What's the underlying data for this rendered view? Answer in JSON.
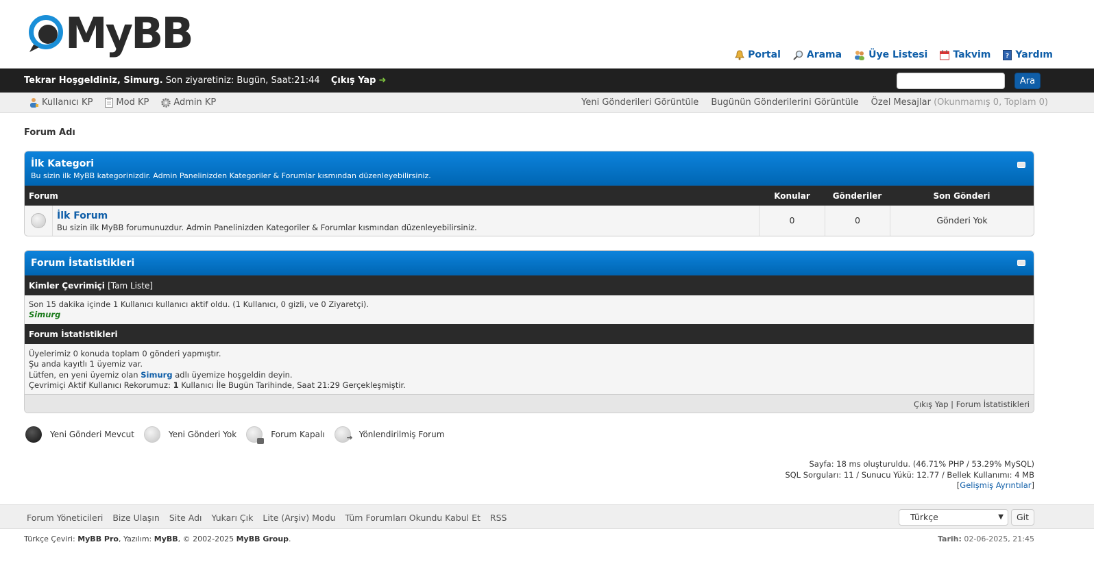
{
  "logo": {
    "text": "MyBB"
  },
  "menu": {
    "portal": "Portal",
    "search": "Arama",
    "members": "Üye Listesi",
    "calendar": "Takvim",
    "help": "Yardım"
  },
  "panel": {
    "welcome_bold": "Tekrar Hoşgeldiniz, Simurg.",
    "last_visit": "Son ziyaretiniz: Bugün, Saat:21:44",
    "logout": "Çıkış Yap",
    "logout_arrow": "➜",
    "search_value": "",
    "search_button": "Ara"
  },
  "userbar": {
    "user_cp": "Kullanıcı KP",
    "mod_cp": "Mod KP",
    "admin_cp": "Admin KP",
    "new_posts": "Yeni Gönderileri Görüntüle",
    "today_posts": "Bugünün Gönderilerini Görüntüle",
    "pm": "Özel Mesajlar",
    "pm_counts": "(Okunmamış 0, Toplam 0)"
  },
  "breadcrumb": "Forum Adı",
  "category": {
    "title": "İlk Kategori",
    "description": "Bu sizin ilk MyBB kategorinizdir. Admin Panelinizden Kategoriler & Forumlar kısmından düzenleyebilirsiniz.",
    "columns": {
      "forum": "Forum",
      "threads": "Konular",
      "posts": "Gönderiler",
      "last_post": "Son Gönderi"
    },
    "forums": [
      {
        "name": "İlk Forum",
        "description": "Bu sizin ilk MyBB forumunuzdur. Admin Panelinizden Kategoriler & Forumlar kısmından düzenleyebilirsiniz.",
        "threads": "0",
        "posts": "0",
        "last_post": "Gönderi Yok"
      }
    ]
  },
  "stats": {
    "title": "Forum İstatistikleri",
    "online_header": "Kimler Çevrimiçi",
    "online_full_list": "[Tam Liste]",
    "online_text": "Son 15 dakika içinde 1 Kullanıcı kullanıcı aktif oldu. (1 Kullanıcı, 0 gizli, ve 0 Ziyaretçi).",
    "online_user": "Simurg",
    "stats_header": "Forum İstatistikleri",
    "line1": "Üyelerimiz 0 konuda toplam 0 gönderi yapmıştır.",
    "line2": "Şu anda kayıtlı 1 üyemiz var.",
    "line3_pre": "Lütfen, en yeni üyemiz olan",
    "line3_user": "Simurg",
    "line3_post": "adlı üyemize hoşgeldin deyin.",
    "line4_pre": "Çevrimiçi Aktif Kullanıcı Rekorumuz:",
    "line4_num": "1",
    "line4_post": "Kullanıcı İle Bugün Tarihinde, Saat 21:29 Gerçekleşmiştir.",
    "footer_logout": "Çıkış Yap",
    "footer_sep": "|",
    "footer_stats": "Forum İstatistikleri"
  },
  "legend": {
    "new": "Yeni Gönderi Mevcut",
    "none": "Yeni Gönderi Yok",
    "locked": "Forum Kapalı",
    "redirect": "Yönlendirilmiş Forum"
  },
  "debug": {
    "line1": "Sayfa: 18 ms oluşturuldu. (46.71% PHP / 53.29% MySQL)",
    "line2": "SQL Sorguları: 11 / Sunucu Yükü: 12.77 / Bellek Kullanımı: 4 MB",
    "advanced": "Gelişmiş Ayrıntılar"
  },
  "footer": {
    "links": [
      "Forum Yöneticileri",
      "Bize Ulaşın",
      "Site Adı",
      "Yukarı Çık",
      "Lite (Arşiv) Modu",
      "Tüm Forumları Okundu Kabul Et",
      "RSS"
    ],
    "language": "Türkçe",
    "go": "Git",
    "copyright_pre": "Türkçe Çeviri:",
    "copyright_pro": "MyBB Pro",
    "copyright_mid": ", Yazılım:",
    "copyright_mybb": "MyBB",
    "copyright_years": ", © 2002-2025",
    "copyright_group": "MyBB Group",
    "copyright_end": ".",
    "date_label": "Tarih:",
    "date_value": "02-06-2025, 21:45"
  },
  "colors": {
    "accent": "#0f5ea8",
    "header_blue": "#0076c8",
    "dark_bar": "#202020",
    "online_user": "#1a7a1a"
  }
}
